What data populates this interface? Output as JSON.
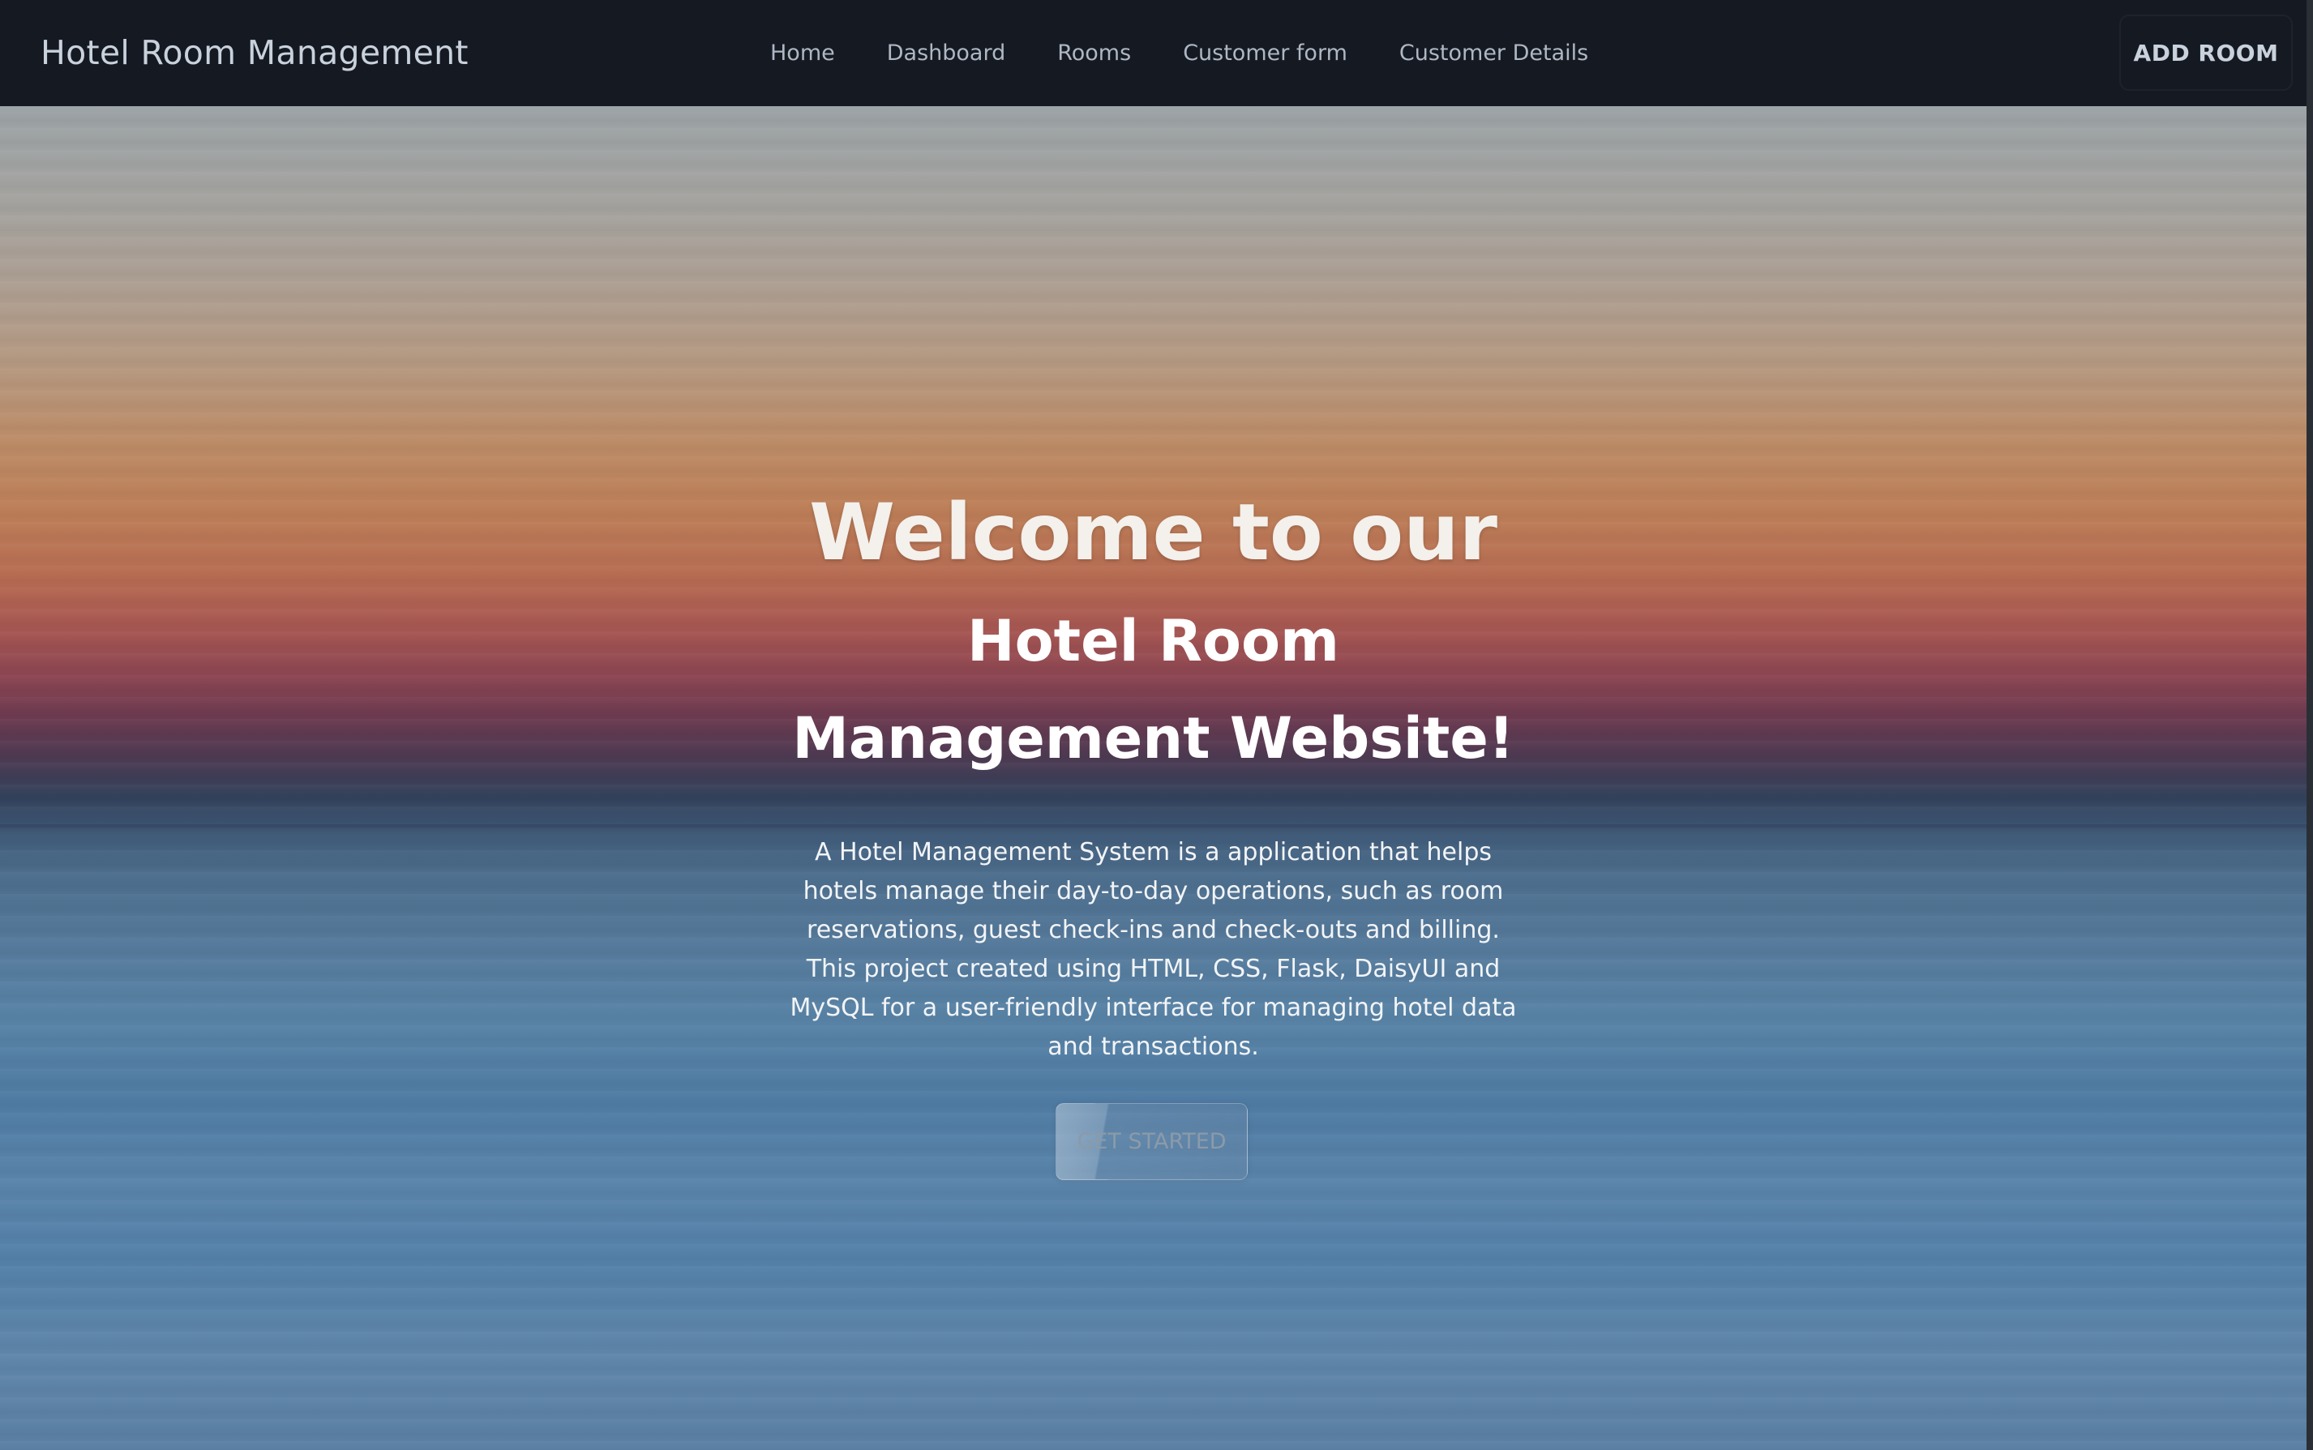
{
  "navbar": {
    "brand": "Hotel Room Management",
    "links": [
      {
        "label": "Home"
      },
      {
        "label": "Dashboard"
      },
      {
        "label": "Rooms"
      },
      {
        "label": "Customer form"
      },
      {
        "label": "Customer Details"
      }
    ],
    "action_label": "ADD ROOM"
  },
  "hero": {
    "title": "Welcome to our",
    "subtitle": "Hotel Room Management Website!",
    "description": "A Hotel Management System is a application that helps hotels manage their day-to-day operations, such as room reservations, guest check-ins and check-outs and billing. This project created using HTML, CSS, Flask, DaisyUI and MySQL for a user-friendly interface for managing hotel data and transactions.",
    "cta_label": "GET STARTED"
  },
  "colors": {
    "navbar_bg": "#151a22",
    "nav_text": "#aeb7c3",
    "sky_top": "#9ca3a6",
    "sunset_orange": "#bd7f58",
    "sunset_red": "#a65652",
    "sea_blue": "#5883a6"
  }
}
